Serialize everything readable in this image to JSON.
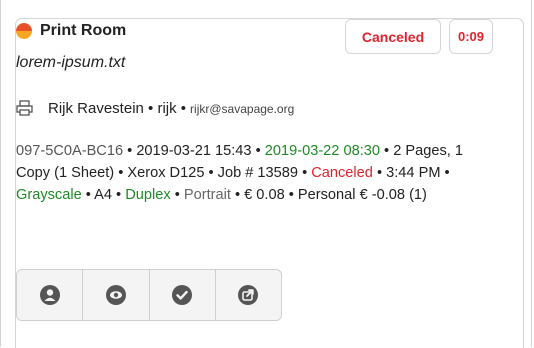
{
  "card": {
    "title": "Print Room",
    "status_badge": "Canceled",
    "time_badge": "0:09",
    "filename": "lorem-ipsum.txt",
    "user": {
      "name_line": "Rijk Ravestein • rijk •",
      "email": "rijkr@savapage.org"
    },
    "details": {
      "doc_id": "097-5C0A-BC16",
      "sep": " • ",
      "created": "2019-03-21 15:43",
      "expires": "2019-03-22 08:30",
      "pages": "2 Pages, 1 Copy (1 Sheet)",
      "printer": "Xerox D125",
      "job": "Job # 13589",
      "state": "Canceled",
      "state_time": "3:44 PM",
      "color_mode": "Grayscale",
      "paper": "A4",
      "duplex": "Duplex",
      "orientation": "Portrait",
      "cost": "€ 0.08",
      "account": "Personal € -0.08 (1)"
    },
    "toolbar": [
      {
        "icon": "user-icon"
      },
      {
        "icon": "eye-icon"
      },
      {
        "icon": "check-icon"
      },
      {
        "icon": "share-icon"
      }
    ]
  },
  "colors": {
    "accent_red": "#e0242c",
    "accent_green": "#1e8a26",
    "status_orange": "#e8522a"
  }
}
